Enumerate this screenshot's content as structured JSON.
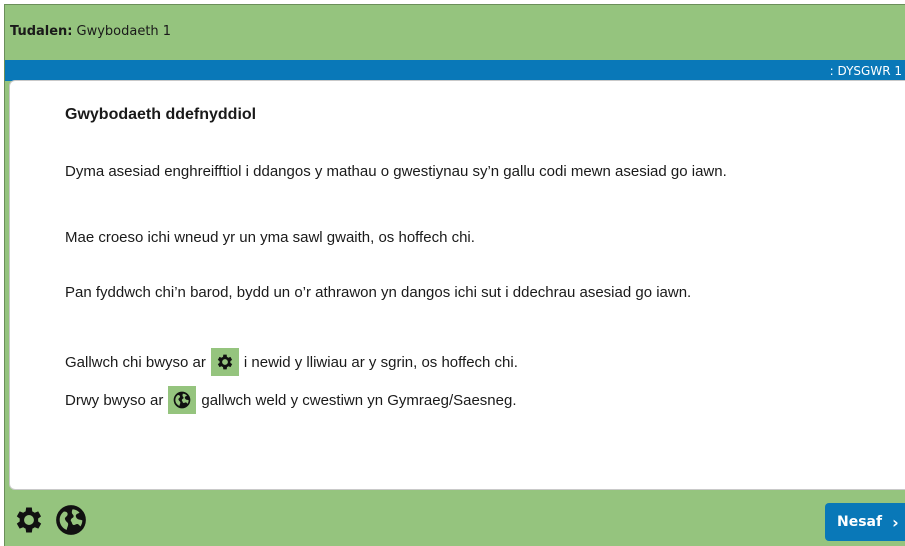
{
  "header": {
    "label": "Tudalen:",
    "page_name": "Gwybodaeth 1"
  },
  "status_bar": {
    "text": ": DYSGWR 1"
  },
  "content": {
    "heading": "Gwybodaeth ddefnyddiol",
    "para1": "Dyma asesiad enghreifftiol i ddangos y mathau o gwestiynau sy’n gallu codi mewn asesiad go iawn.",
    "para2": "Mae croeso ichi wneud yr un yma sawl gwaith, os hoffech chi.",
    "para3": "Pan fyddwch chi’n barod, bydd un o’r athrawon yn dangos ichi sut i ddechrau asesiad go iawn.",
    "settings_line": {
      "before": "Gallwch chi bwyso ar",
      "after": "i newid y lliwiau ar y sgrin, os hoffech chi."
    },
    "language_line": {
      "before": "Drwy bwyso ar",
      "after": "gallwch weld y cwestiwn yn Gymraeg/Saesneg."
    }
  },
  "footer": {
    "settings_icon": "gear-icon",
    "language_icon": "globe-icon",
    "next_label": "Nesaf",
    "next_chevron": "›"
  },
  "colors": {
    "green": "#95c47e",
    "blue": "#0978b8"
  }
}
